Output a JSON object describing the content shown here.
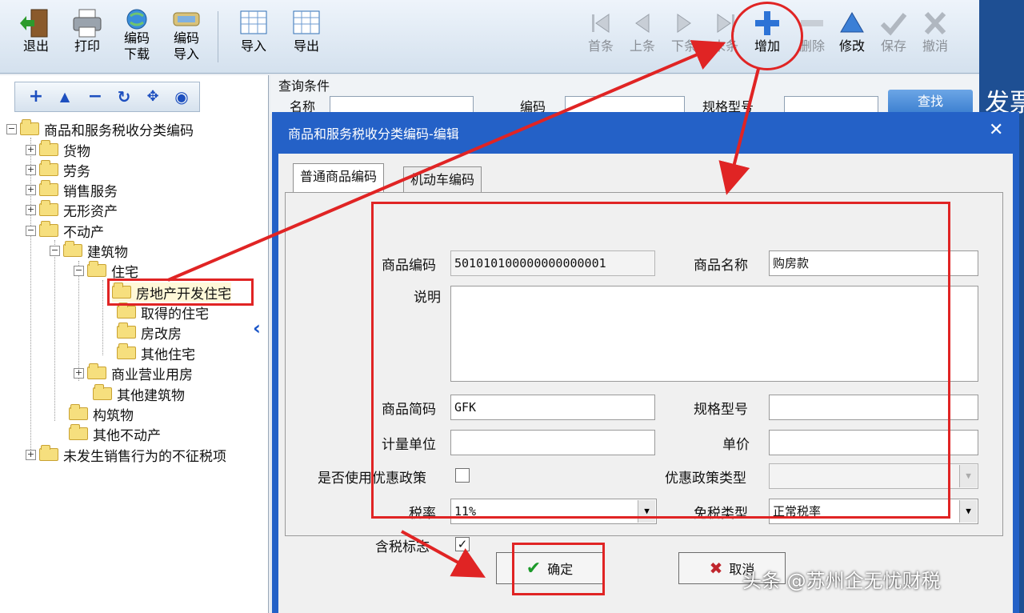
{
  "toolbar": {
    "exit": "退出",
    "print": "打印",
    "code_download_1": "编码",
    "code_download_2": "下载",
    "code_import_1": "编码",
    "code_import_2": "导入",
    "import": "导入",
    "export": "导出",
    "first": "首条",
    "prev": "上条",
    "next": "下条",
    "last": "末条",
    "add": "增加",
    "delete": "删除",
    "modify": "修改",
    "save": "保存",
    "cancel": "撤消"
  },
  "right_strip_text": "发票",
  "tree": {
    "root": "商品和服务税收分类编码",
    "goods": "货物",
    "labor": "劳务",
    "services": "销售服务",
    "intangible": "无形资产",
    "real_estate": "不动产",
    "buildings": "建筑物",
    "residential": "住宅",
    "dev_residential": "房地产开发住宅",
    "acquired": "取得的住宅",
    "reformed": "房改房",
    "other_res": "其他住宅",
    "commercial": "商业营业用房",
    "other_build": "其他建筑物",
    "structures": "构筑物",
    "other_re": "其他不动产",
    "non_taxable": "未发生销售行为的不征税项"
  },
  "query": {
    "legend": "查询条件",
    "name_label": "名称",
    "code_label": "编码",
    "spec_label": "规格型号",
    "search_button": "查找"
  },
  "dialog": {
    "title": "商品和服务税收分类编码-编辑",
    "tab_general": "普通商品编码",
    "tab_vehicle": "机动车编码",
    "code_label": "商品编码",
    "code_value": "501010100000000000001",
    "name_label": "商品名称",
    "name_value": "购房款",
    "desc_label": "说明",
    "short_code_label": "商品简码",
    "short_code_value": "GFK",
    "spec_label": "规格型号",
    "unit_label": "计量单位",
    "price_label": "单价",
    "preferential_label": "是否使用优惠政策",
    "preferential_type_label": "优惠政策类型",
    "tax_rate_label": "税率",
    "tax_rate_value": "11%",
    "exempt_type_label": "免税类型",
    "exempt_type_value": "正常税率",
    "tax_incl_label": "含税标志",
    "tax_incl_check": "✓",
    "ok_button": "确定",
    "cancel_button": "取消"
  },
  "watermark": "头条 @苏州企无忧财税",
  "colors": {
    "dialog_title": "#2461c7",
    "highlight": "#e02424",
    "accent": "#1a55c8"
  }
}
